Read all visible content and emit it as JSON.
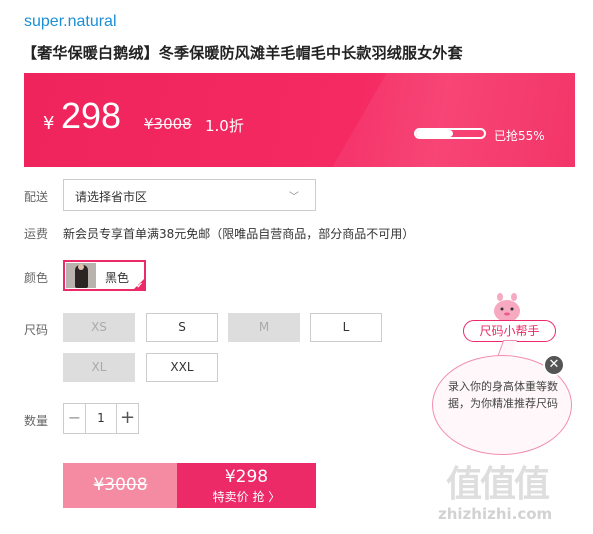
{
  "brand": "super.natural",
  "title": "【奢华保暖白鹅绒】冬季保暖防风滩羊毛帽毛中长款羽绒服女外套",
  "price": {
    "currency": "¥",
    "now": "298",
    "original": "¥3008",
    "discount": "1.0折",
    "sold_text": "已抢55%",
    "sold_fraction": 0.55
  },
  "delivery": {
    "label": "配送",
    "placeholder": "请选择省市区"
  },
  "shipping": {
    "label": "运费",
    "text": "新会员专享首单满38元免邮（限唯品自营商品，部分商品不可用）"
  },
  "color": {
    "label": "颜色",
    "selected": "黑色"
  },
  "size": {
    "label": "尺码",
    "options": [
      {
        "name": "XS",
        "available": false
      },
      {
        "name": "S",
        "available": true
      },
      {
        "name": "M",
        "available": false
      },
      {
        "name": "L",
        "available": true
      },
      {
        "name": "XL",
        "available": false
      },
      {
        "name": "XXL",
        "available": true
      }
    ]
  },
  "quantity": {
    "label": "数量",
    "value": "1",
    "minus": "−",
    "plus": "+"
  },
  "buy": {
    "original": "¥3008",
    "price": "¥298",
    "label": "特卖价 抢 〉"
  },
  "size_helper": {
    "badge": "尺码小帮手",
    "bubble_text": "录入你的身高体重等数据，为你精准推荐尺码",
    "close": "✕"
  },
  "watermark": {
    "logo": "值值值",
    "url": "zhizhizhi.com"
  },
  "colors": {
    "accent": "#ec2a68",
    "banner": "#f0245c",
    "brand_link": "#1a8fd8"
  }
}
